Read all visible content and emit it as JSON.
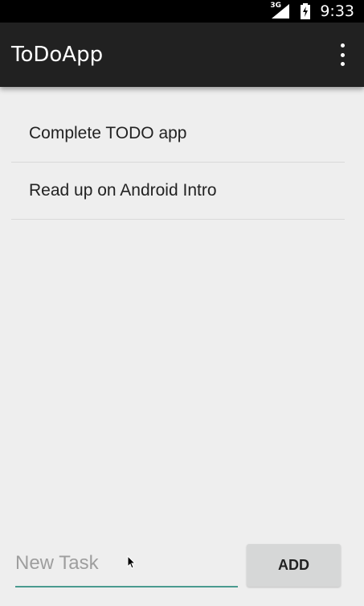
{
  "status_bar": {
    "network_type": "3G",
    "time": "9:33"
  },
  "app_bar": {
    "title": "ToDoApp",
    "menu_icon": "overflow-menu-icon"
  },
  "tasks": [
    {
      "label": "Complete TODO app"
    },
    {
      "label": "Read up on Android Intro"
    }
  ],
  "new_task": {
    "placeholder": "New Task",
    "value": ""
  },
  "add_button": {
    "label": "ADD"
  },
  "colors": {
    "status_bar": "#000000",
    "app_bar": "#212121",
    "background": "#eeeeee",
    "accent": "#4a9a8f",
    "button": "#d6d7d7"
  }
}
